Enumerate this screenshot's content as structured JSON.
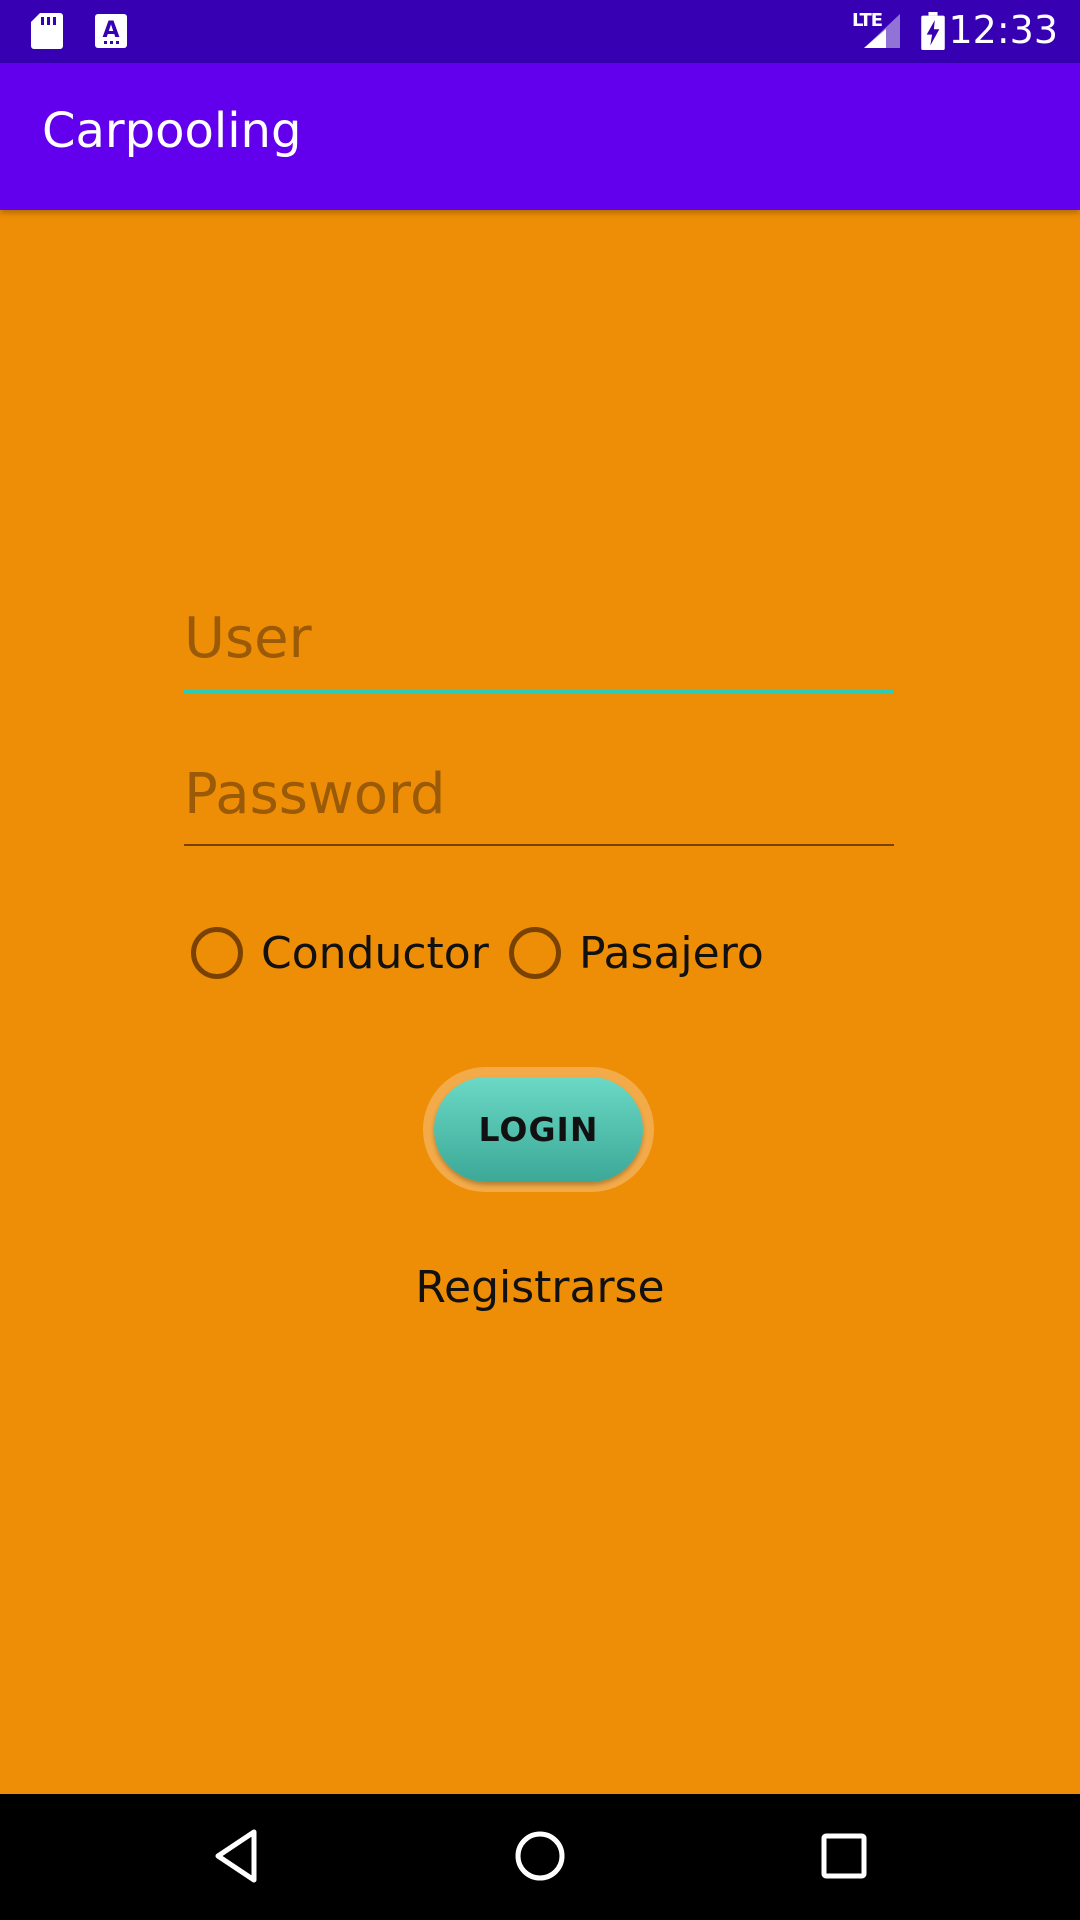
{
  "status_bar": {
    "time": "12:33",
    "network": "LTE",
    "icons": [
      "sd-card-icon",
      "text-recognition-icon",
      "signal-icon",
      "battery-charging-icon"
    ]
  },
  "app_bar": {
    "title": "Carpooling"
  },
  "form": {
    "user_placeholder": "User",
    "user_value": "",
    "password_placeholder": "Password",
    "password_value": "",
    "role_options": [
      "Conductor",
      "Pasajero"
    ],
    "login_label": "LOGIN",
    "register_label": "Registrarse"
  },
  "nav_bar": {
    "icons": [
      "back-icon",
      "home-icon",
      "recents-icon"
    ]
  },
  "colors": {
    "background": "#EE8E07",
    "app_bar": "#6200EE",
    "status_bar": "#3700B3",
    "accent": "#2CCDB6",
    "button": "#4EC2AF"
  }
}
